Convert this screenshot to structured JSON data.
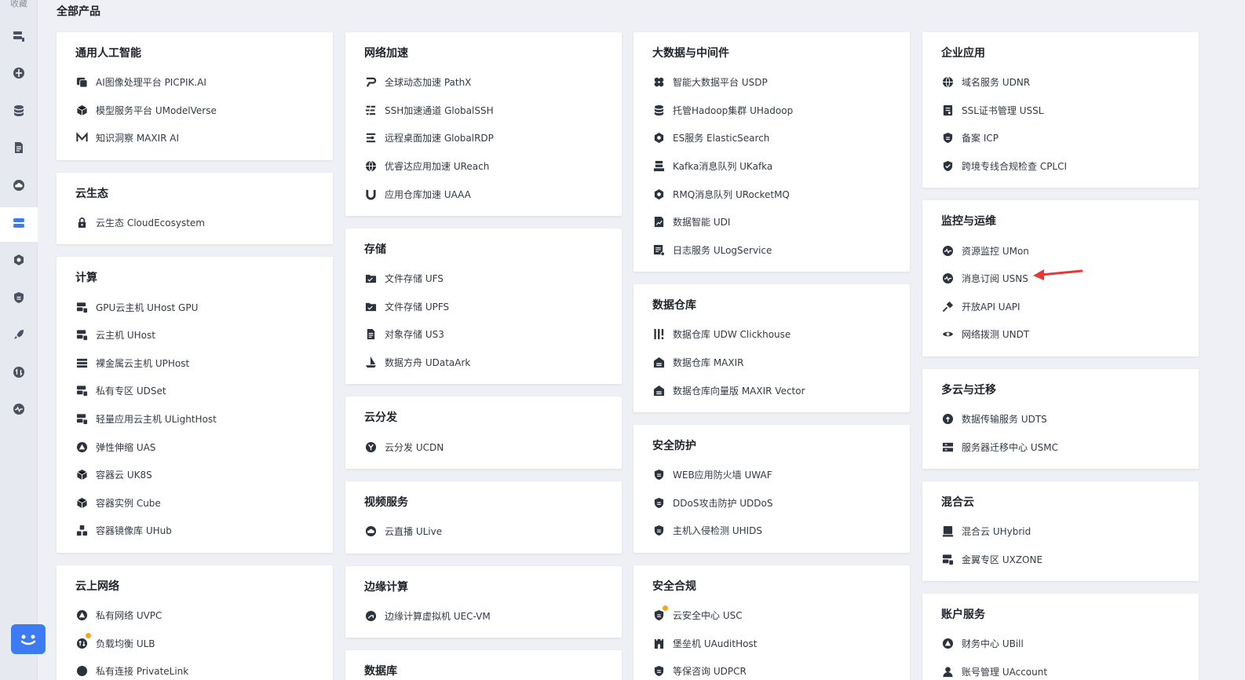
{
  "rail": {
    "top_label": "收藏",
    "icons": [
      "host-icon",
      "network-icon",
      "database-icon",
      "document-icon",
      "cloud-icon",
      "storage-icon",
      "hex-icon",
      "shield-icon",
      "rocket-icon",
      "transfer-icon",
      "monitor-icon"
    ],
    "active_index": 5
  },
  "page": {
    "title": "全部产品"
  },
  "columns": [
    [
      {
        "title": "通用人工智能",
        "items": [
          {
            "label": "AI图像处理平台 PICPIK.AI",
            "icon": "image-icon"
          },
          {
            "label": "模型服务平台 UModelVerse",
            "icon": "cube-icon"
          },
          {
            "label": "知识洞察 MAXIR AI",
            "icon": "m-logo-icon"
          }
        ]
      },
      {
        "title": "云生态",
        "items": [
          {
            "label": "云生态 CloudEcosystem",
            "icon": "lock-icon"
          }
        ]
      },
      {
        "title": "计算",
        "items": [
          {
            "label": "GPU云主机 UHost GPU",
            "icon": "server-icon"
          },
          {
            "label": "云主机 UHost",
            "icon": "server-icon"
          },
          {
            "label": "裸金属云主机 UPHost",
            "icon": "rack-icon"
          },
          {
            "label": "私有专区 UDSet",
            "icon": "server-icon"
          },
          {
            "label": "轻量应用云主机 ULightHost",
            "icon": "server-icon"
          },
          {
            "label": "弹性伸缩 UAS",
            "icon": "triangle-icon"
          },
          {
            "label": "容器云 UK8S",
            "icon": "cube-icon"
          },
          {
            "label": "容器实例 Cube",
            "icon": "cube-icon"
          },
          {
            "label": "容器镜像库 UHub",
            "icon": "cubes-icon"
          }
        ]
      },
      {
        "title": "云上网络",
        "items": [
          {
            "label": "私有网络 UVPC",
            "icon": "triangle-icon"
          },
          {
            "label": "负载均衡 ULB",
            "icon": "balance-icon",
            "dot": true
          },
          {
            "label": "私有连接 PrivateLink",
            "icon": "link-icon"
          }
        ]
      }
    ],
    [
      {
        "title": "网络加速",
        "items": [
          {
            "label": "全球动态加速 PathX",
            "icon": "pathx-icon"
          },
          {
            "label": "SSH加速通道 GlobalSSH",
            "icon": "ssh-icon"
          },
          {
            "label": "远程桌面加速 GlobalRDP",
            "icon": "rdp-icon"
          },
          {
            "label": "优睿达应用加速 UReach",
            "icon": "globe-icon"
          },
          {
            "label": "应用仓库加速 UAAA",
            "icon": "u-icon"
          }
        ]
      },
      {
        "title": "存储",
        "items": [
          {
            "label": "文件存储 UFS",
            "icon": "folder-icon"
          },
          {
            "label": "文件存储 UPFS",
            "icon": "folder-icon"
          },
          {
            "label": "对象存储 US3",
            "icon": "document-icon"
          },
          {
            "label": "数据方舟 UDataArk",
            "icon": "ship-icon"
          }
        ]
      },
      {
        "title": "云分发",
        "items": [
          {
            "label": "云分发 UCDN",
            "icon": "branch-icon"
          }
        ]
      },
      {
        "title": "视频服务",
        "items": [
          {
            "label": "云直播 ULive",
            "icon": "cloud-icon"
          }
        ]
      },
      {
        "title": "边缘计算",
        "items": [
          {
            "label": "边缘计算虚拟机 UEC-VM",
            "icon": "edge-icon"
          }
        ]
      },
      {
        "title": "数据库",
        "items": []
      }
    ],
    [
      {
        "title": "大数据与中间件",
        "items": [
          {
            "label": "智能大数据平台 USDP",
            "icon": "cluster-icon"
          },
          {
            "label": "托管Hadoop集群 UHadoop",
            "icon": "database-icon"
          },
          {
            "label": "ES服务 ElasticSearch",
            "icon": "hex-icon"
          },
          {
            "label": "Kafka消息队列 UKafka",
            "icon": "queue-icon"
          },
          {
            "label": "RMQ消息队列 URocketMQ",
            "icon": "hex-icon"
          },
          {
            "label": "数据智能 UDI",
            "icon": "chart-doc-icon"
          },
          {
            "label": "日志服务 ULogService",
            "icon": "log-icon"
          }
        ]
      },
      {
        "title": "数据仓库",
        "items": [
          {
            "label": "数据仓库 UDW Clickhouse",
            "icon": "bars-icon"
          },
          {
            "label": "数据仓库 MAXIR",
            "icon": "warehouse-icon"
          },
          {
            "label": "数据仓库向量版 MAXIR Vector",
            "icon": "warehouse-icon"
          }
        ]
      },
      {
        "title": "安全防护",
        "items": [
          {
            "label": "WEB应用防火墙 UWAF",
            "icon": "shield-icon"
          },
          {
            "label": "DDoS攻击防护 UDDoS",
            "icon": "shield-icon"
          },
          {
            "label": "主机入侵检测 UHIDS",
            "icon": "shield-icon"
          }
        ]
      },
      {
        "title": "安全合规",
        "items": [
          {
            "label": "云安全中心 USC",
            "icon": "shield-icon",
            "dot": true
          },
          {
            "label": "堡垒机 UAuditHost",
            "icon": "castle-icon"
          },
          {
            "label": "等保咨询 UDPCR",
            "icon": "shield-icon"
          }
        ]
      }
    ],
    [
      {
        "title": "企业应用",
        "items": [
          {
            "label": "域名服务 UDNR",
            "icon": "globe-icon"
          },
          {
            "label": "SSL证书管理 USSL",
            "icon": "certificate-icon"
          },
          {
            "label": "备案 ICP",
            "icon": "shield-icon"
          },
          {
            "label": "跨境专线合规检查 CPLCI",
            "icon": "shield-check-icon"
          }
        ]
      },
      {
        "title": "监控与运维",
        "items": [
          {
            "label": "资源监控 UMon",
            "icon": "pulse-icon"
          },
          {
            "label": "消息订阅 USNS",
            "icon": "pulse-icon"
          },
          {
            "label": "开放API UAPI",
            "icon": "plug-icon"
          },
          {
            "label": "网络拨测 UNDT",
            "icon": "eye-icon"
          }
        ]
      },
      {
        "title": "多云与迁移",
        "items": [
          {
            "label": "数据传输服务 UDTS",
            "icon": "cloud-upload-icon"
          },
          {
            "label": "服务器迁移中心 USMC",
            "icon": "migrate-icon"
          }
        ]
      },
      {
        "title": "混合云",
        "items": [
          {
            "label": "混合云 UHybrid",
            "icon": "terminal-icon"
          },
          {
            "label": "金翼专区 UXZONE",
            "icon": "server-icon"
          }
        ]
      },
      {
        "title": "账户服务",
        "items": [
          {
            "label": "财务中心 UBill",
            "icon": "triangle-icon"
          },
          {
            "label": "账号管理 UAccount",
            "icon": "user-icon"
          }
        ]
      }
    ]
  ],
  "colors": {
    "background": "#eef0f5",
    "card": "#ffffff",
    "icon": "#2d333d",
    "annotation_arrow": "#e53935",
    "dot": "#f5a623",
    "chat": "#3d7bf5"
  }
}
